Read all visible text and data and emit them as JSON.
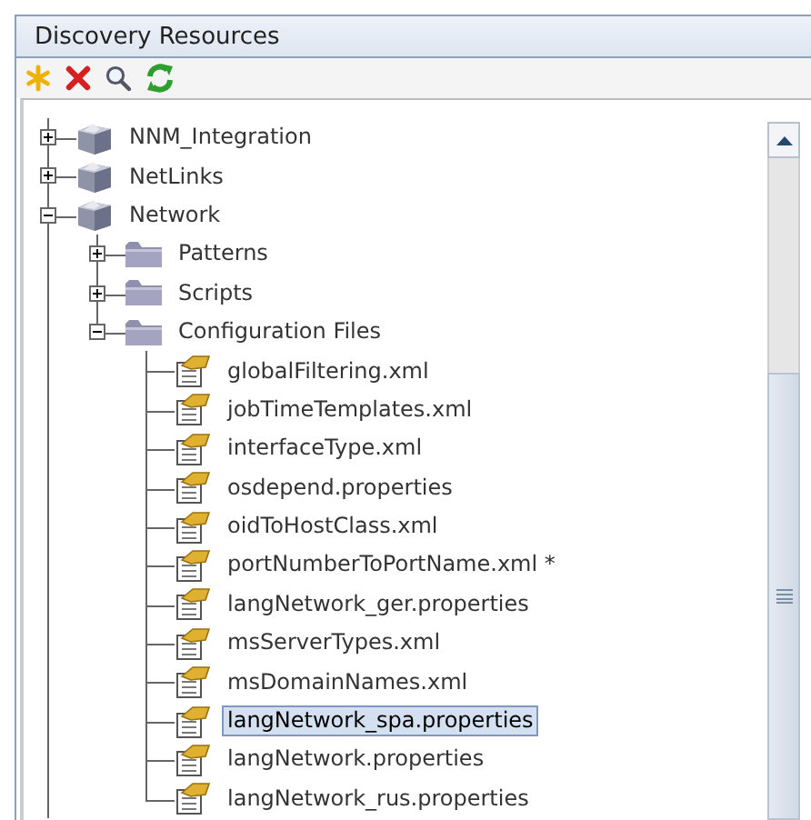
{
  "panel": {
    "title": "Discovery Resources"
  },
  "toolbar": [
    {
      "kind": "new"
    },
    {
      "kind": "delete"
    },
    {
      "kind": "search"
    },
    {
      "kind": "refresh"
    }
  ],
  "tree": [
    {
      "label": "NNM_Integration",
      "kind": "server",
      "expanded": false,
      "selected": false
    },
    {
      "label": "NetLinks",
      "kind": "server",
      "expanded": false,
      "selected": false
    },
    {
      "label": "Network",
      "kind": "server",
      "expanded": true,
      "selected": false,
      "children": [
        {
          "label": "Patterns",
          "kind": "folder",
          "expanded": false,
          "selected": false
        },
        {
          "label": "Scripts",
          "kind": "folder",
          "expanded": false,
          "selected": false
        },
        {
          "label": "Configuration Files",
          "kind": "folder",
          "expanded": true,
          "selected": false,
          "children": [
            {
              "label": "globalFiltering.xml",
              "kind": "file",
              "selected": false
            },
            {
              "label": "jobTimeTemplates.xml",
              "kind": "file",
              "selected": false
            },
            {
              "label": "interfaceType.xml",
              "kind": "file",
              "selected": false
            },
            {
              "label": "osdepend.properties",
              "kind": "file",
              "selected": false
            },
            {
              "label": "oidToHostClass.xml",
              "kind": "file",
              "selected": false
            },
            {
              "label": "portNumberToPortName.xml *",
              "kind": "file",
              "selected": false
            },
            {
              "label": "langNetwork_ger.properties",
              "kind": "file",
              "selected": false
            },
            {
              "label": "msServerTypes.xml",
              "kind": "file",
              "selected": false
            },
            {
              "label": "msDomainNames.xml",
              "kind": "file",
              "selected": false
            },
            {
              "label": "langNetwork_spa.properties",
              "kind": "file",
              "selected": true
            },
            {
              "label": "langNetwork.properties",
              "kind": "file",
              "selected": false
            },
            {
              "label": "langNetwork_rus.properties",
              "kind": "file",
              "selected": false
            }
          ]
        }
      ]
    }
  ]
}
